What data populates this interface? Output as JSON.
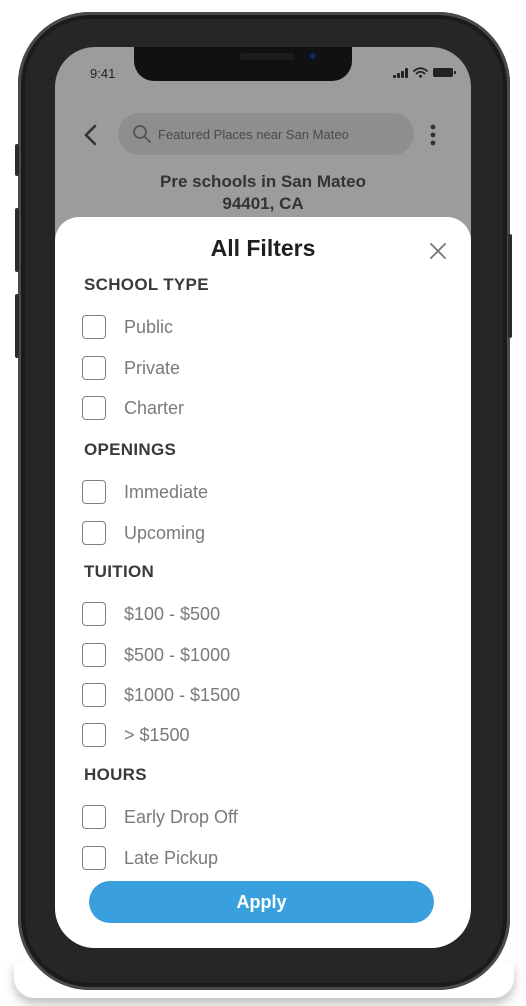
{
  "status_bar": {
    "time": "9:41"
  },
  "header": {
    "search_placeholder": "Featured Places near San Mateo",
    "title_line1": "Pre schools in San Mateo",
    "title_line2": "94401, CA"
  },
  "filters": {
    "title": "All Filters",
    "sections": {
      "school_type": {
        "title": "SCHOOL TYPE",
        "options": [
          "Public",
          "Private",
          "Charter"
        ]
      },
      "openings": {
        "title": "OPENINGS",
        "options": [
          "Immediate",
          "Upcoming"
        ]
      },
      "tuition": {
        "title": "TUITION",
        "options": [
          "$100 - $500",
          "$500 - $1000",
          "$1000 - $1500",
          "> $1500"
        ]
      },
      "hours": {
        "title": "HOURS",
        "options": [
          "Early Drop Off",
          "Late Pickup"
        ]
      }
    },
    "apply_label": "Apply"
  },
  "colors": {
    "accent": "#3aa0dd",
    "overlay": "#9c9c9c"
  },
  "icons": [
    "back-arrow-icon",
    "search-icon",
    "more-vertical-icon",
    "close-icon",
    "signal-icon",
    "wifi-icon",
    "battery-icon"
  ]
}
